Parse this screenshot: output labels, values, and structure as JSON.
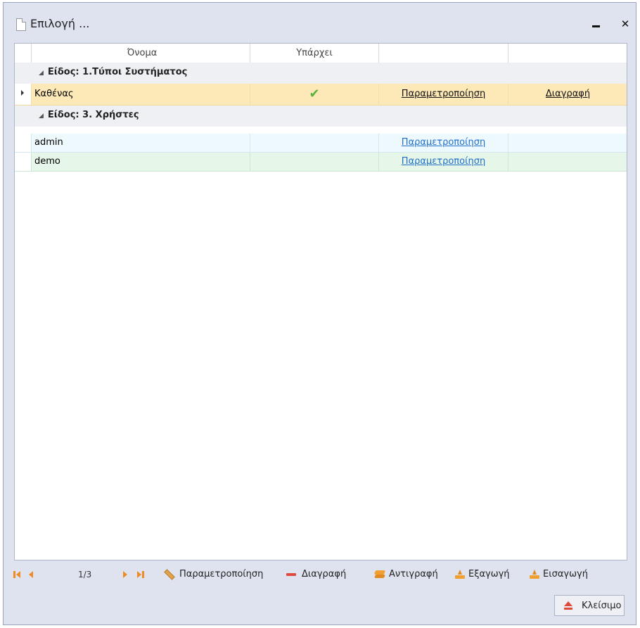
{
  "window": {
    "title": "Επιλογή ..."
  },
  "grid": {
    "columns": [
      "Όνομα",
      "Υπάρχει",
      "",
      ""
    ],
    "groups": [
      {
        "label": "Είδος: 1.Τύποι Συστήματος",
        "rows": [
          {
            "name": "Καθένας",
            "exists": true,
            "edit": "Παραμετροποίηση",
            "delete": "Διαγραφή",
            "selected": true
          }
        ]
      },
      {
        "label": "Είδος: 3. Χρήστες",
        "rows": [
          {
            "name": "admin",
            "exists": false,
            "edit": "Παραμετροποίηση",
            "delete": ""
          },
          {
            "name": "demo",
            "exists": false,
            "edit": "Παραμετροποίηση",
            "delete": ""
          }
        ]
      }
    ]
  },
  "navigator": {
    "page": "1/3",
    "edit_label": "Παραμετροποίηση",
    "delete_label": "Διαγραφή",
    "copy_label": "Αντιγραφή",
    "export_label": "Εξαγωγή",
    "import_label": "Εισαγωγή"
  },
  "footer": {
    "close_label": "Κλείσιμο"
  },
  "colors": {
    "accent": "#f08a24",
    "selected_row": "#fde9b8",
    "link": "#1f6fc9",
    "check": "#5ab33c"
  }
}
